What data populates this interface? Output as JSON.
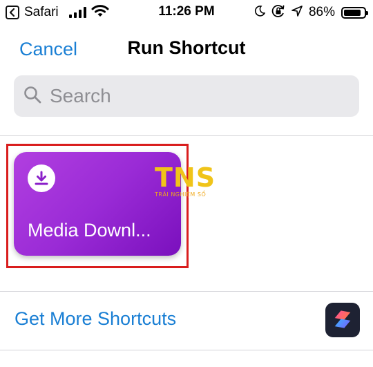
{
  "status_bar": {
    "back_app": "Safari",
    "time": "11:26 PM",
    "battery_percent": "86%",
    "battery_level": 0.86,
    "icons": [
      "back-to-app-icon",
      "cellular-signal-icon",
      "wifi-icon",
      "moon-icon",
      "orientation-lock-icon",
      "location-arrow-icon",
      "battery-icon"
    ]
  },
  "nav": {
    "cancel_label": "Cancel",
    "title": "Run Shortcut"
  },
  "search": {
    "placeholder": "Search",
    "value": "",
    "icon": "search-icon"
  },
  "shortcuts": [
    {
      "label": "Media Downl...",
      "icon": "download-icon",
      "color": "#9a2bd6"
    }
  ],
  "highlight_color": "#d91d1d",
  "watermark": {
    "main": "TNS",
    "sub": "TRẢI NGHIỆM SỐ"
  },
  "footer": {
    "get_more_label": "Get More Shortcuts",
    "app_icon": "shortcuts-app-icon"
  },
  "colors": {
    "accent": "#1a7fd4",
    "watermark": "#f0c419"
  }
}
